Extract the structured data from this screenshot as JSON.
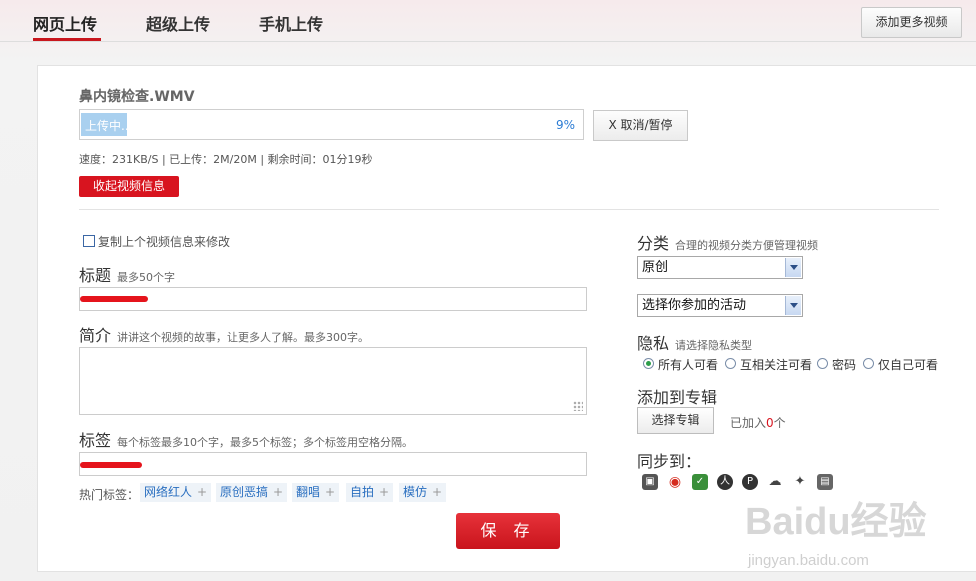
{
  "tabs": [
    "网页上传",
    "超级上传",
    "手机上传"
  ],
  "add_more": "添加更多视频",
  "upload": {
    "filename": "鼻内镜检查.WMV",
    "status": "上传中...",
    "percent_text": "9%",
    "progress": 0.09,
    "cancel": "X  取消/暂停",
    "stats": "速度：231KB/S | 已上传：2M/20M | 剩余时间：01分19秒",
    "collapse": "收起视频信息"
  },
  "form": {
    "copy_prev": "复制上个视频信息来修改",
    "title_label": "标题",
    "title_hint": "最多50个字",
    "intro_label": "简介",
    "intro_hint": "讲讲这个视频的故事，让更多人了解。最多300字。",
    "tags_label": "标签",
    "tags_hint": "每个标签最多10个字，最多5个标签；多个标签用空格分隔。",
    "hot_label": "热门标签：",
    "hot_tags": [
      "网络红人",
      "原创恶搞",
      "翻唱",
      "自拍",
      "模仿"
    ],
    "save": "保 存"
  },
  "side": {
    "category_label": "分类",
    "category_hint": "合理的视频分类方便管理视频",
    "category_value": "原创",
    "activity_value": "选择你参加的活动",
    "privacy_label": "隐私",
    "privacy_hint": "请选择隐私类型",
    "privacy_options": [
      "所有人可看",
      "互相关注可看",
      "密码",
      "仅自己可看"
    ],
    "album_label": "添加到专辑",
    "album_button": "选择专辑",
    "album_added_prefix": "已加入",
    "album_added_count": "0",
    "album_added_suffix": "个",
    "sync_label": "同步到："
  },
  "watermark": {
    "main": "Baidu经验",
    "sub": "jingyan.baidu.com"
  },
  "colors": {
    "accent": "#d8141f",
    "link": "#2a6fc0"
  }
}
